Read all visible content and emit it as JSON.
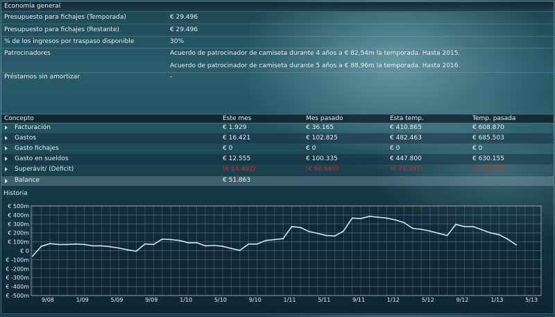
{
  "economy": {
    "title": "Economía general",
    "rows": [
      {
        "label": "Presupuesto para fichajes (Temporada)",
        "value": "€ 29.496"
      },
      {
        "label": "Presupuesto para fichajes (Restante)",
        "value": "€ 29.496"
      },
      {
        "label": "% de los ingresos por traspaso disponible",
        "value": "30%"
      }
    ],
    "sponsors_label": "Patrocinadores",
    "sponsors": [
      "Acuerdo de patrocinador de camiseta durante 4 años a € 82,54m la temporada. Hasta 2015.",
      "Acuerdo de patrocinador de camiseta durante 5 años a € 88,96m la temporada. Hasta 2016."
    ],
    "loans_label": "Préstamos sin amortizar",
    "loans_value": "-"
  },
  "finance_table": {
    "headers": [
      "Concepto",
      "Este mes",
      "Mes pasado",
      "Esta temp.",
      "Temp. pasada"
    ],
    "rows": [
      {
        "concept": "Facturación",
        "values": [
          "€ 1.929",
          "€ 36.165",
          "€ 410.865",
          "€ 608.870"
        ],
        "negative": false
      },
      {
        "concept": "Gastos",
        "values": [
          "€ 16.421",
          "€ 102.825",
          "€ 482.463",
          "€ 685.503"
        ],
        "negative": false
      },
      {
        "concept": "Gasto fichajes",
        "values": [
          "€ 0",
          "€ 0",
          "€ 0",
          "€ 0"
        ],
        "negative": false
      },
      {
        "concept": "Gasto en sueldos",
        "values": [
          "€ 12.555",
          "€ 100.335",
          "€ 447.800",
          "€ 630.155"
        ],
        "negative": false
      },
      {
        "concept": "Superávit/ (Déficit)",
        "values": [
          "(€ 14.492)",
          "(€ 66.660)",
          "(€ 71.597)",
          "(€ 76.633)"
        ],
        "negative": true
      }
    ],
    "balance": {
      "label": "Balance",
      "value": "€ 51.863"
    },
    "negative_color": "#e02020"
  },
  "chart_title": "Historia",
  "chart_data": {
    "type": "line",
    "title": "",
    "xlabel": "",
    "ylabel": "",
    "ylim": [
      -500,
      500
    ],
    "y_unit": "m",
    "yticks": [
      500,
      400,
      300,
      200,
      100,
      0,
      -100,
      -200,
      -300,
      -400,
      -500
    ],
    "ytick_labels": [
      "€ 500m",
      "€ 400m",
      "€ 300m",
      "€ 200m",
      "€ 100m",
      "€ 0",
      "€ -100m",
      "€ -200m",
      "€ -300m",
      "€ -400m",
      "€ -500m"
    ],
    "xtick_labels": [
      "9/08",
      "1/09",
      "5/09",
      "9/09",
      "1/10",
      "5/10",
      "9/10",
      "1/11",
      "5/11",
      "9/11",
      "1/12",
      "5/12",
      "9/12",
      "1/13",
      "5/13"
    ],
    "x_start": "2008-07",
    "x_interval": "month",
    "line_color": "#cfe8f0",
    "grid": true,
    "series": [
      {
        "values": [
          -60,
          50,
          80,
          70,
          70,
          75,
          70,
          55,
          55,
          45,
          30,
          10,
          -5,
          75,
          70,
          130,
          125,
          115,
          90,
          90,
          55,
          60,
          50,
          25,
          5,
          75,
          75,
          115,
          125,
          135,
          270,
          260,
          215,
          195,
          170,
          165,
          220,
          365,
          360,
          385,
          375,
          365,
          345,
          315,
          250,
          240,
          220,
          195,
          170,
          295,
          270,
          270,
          235,
          200,
          180,
          130,
          65
        ]
      }
    ]
  }
}
